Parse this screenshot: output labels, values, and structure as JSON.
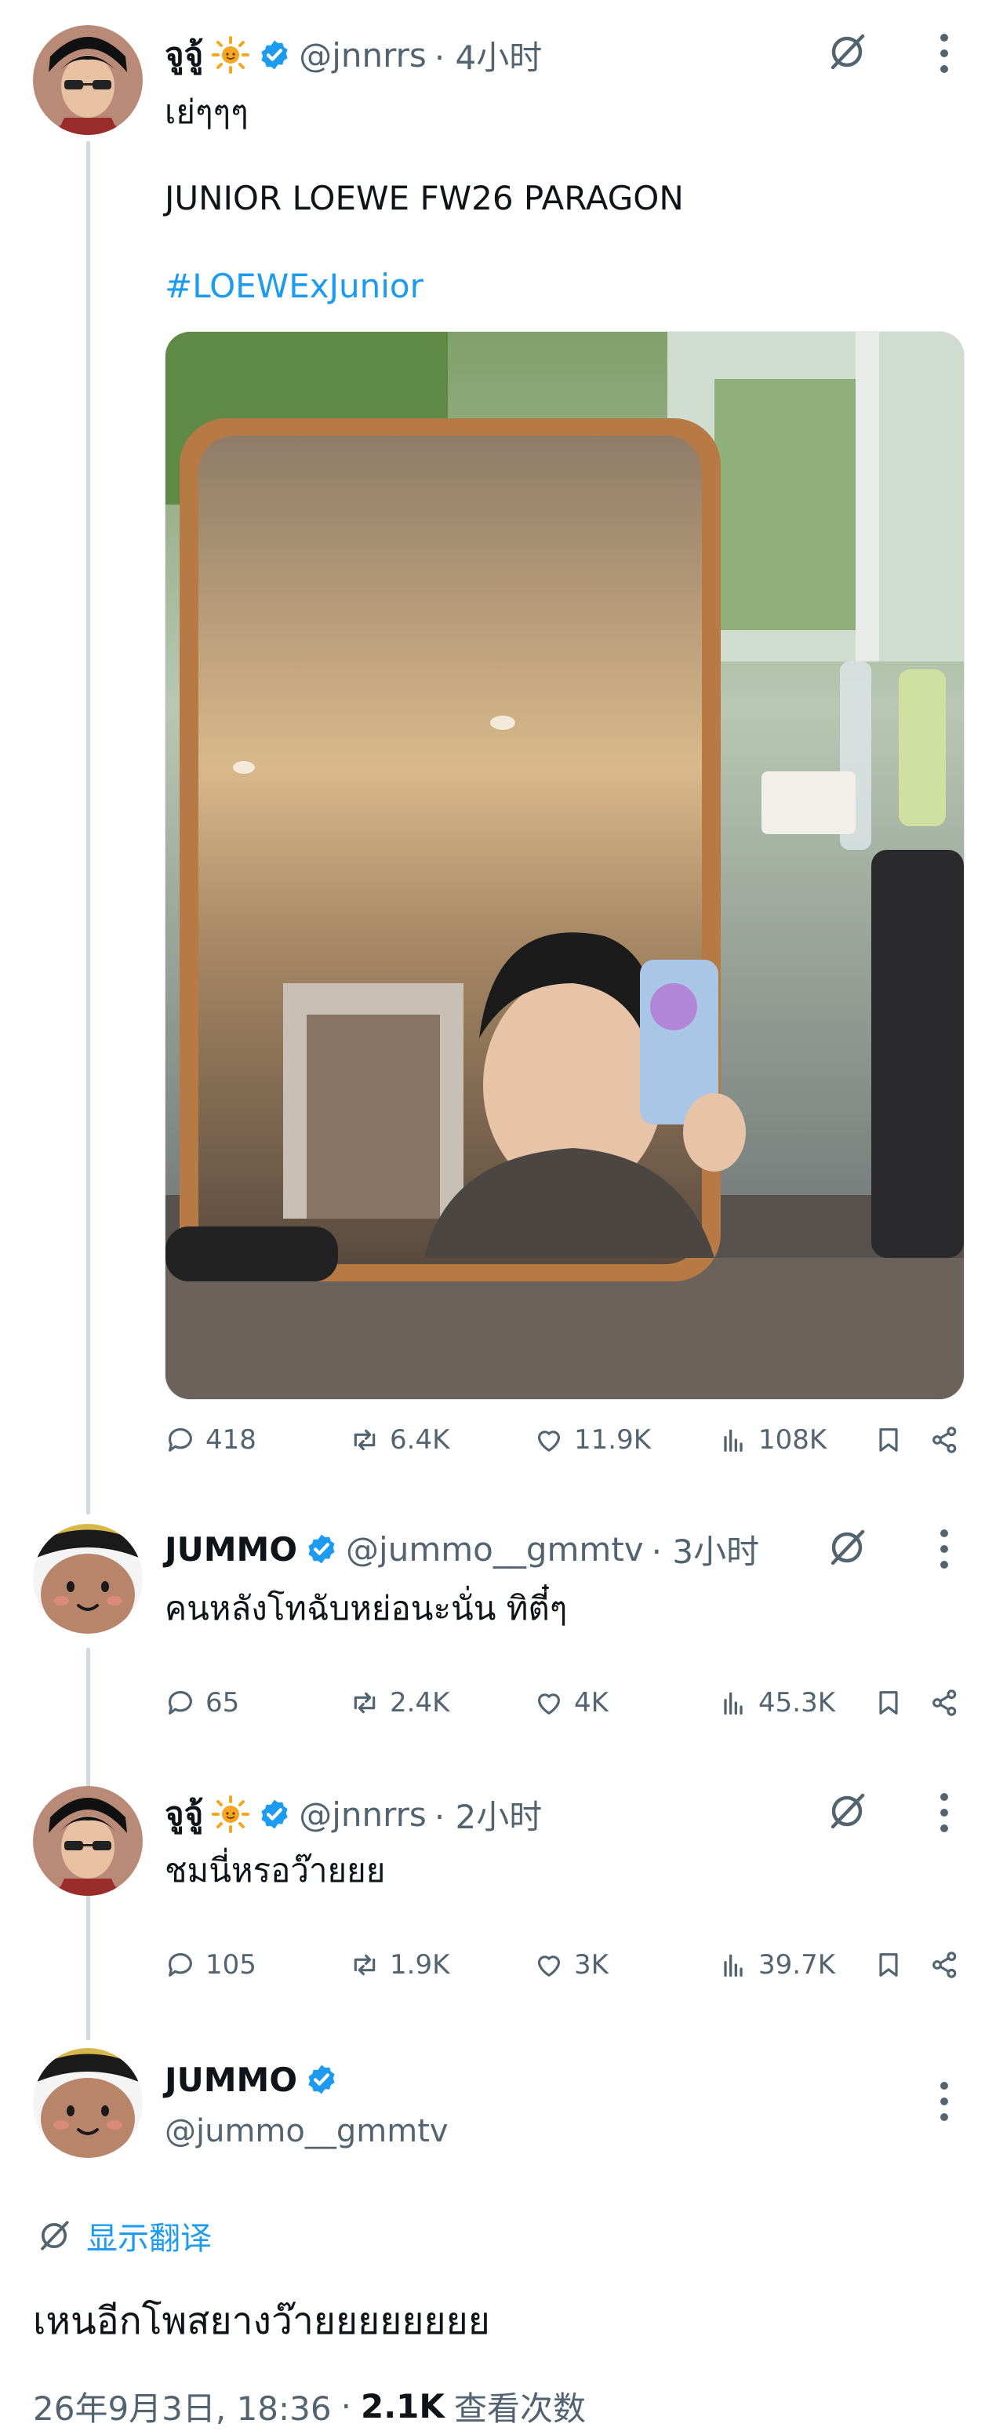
{
  "posts": [
    {
      "display_name": "จูจู้",
      "name_emoji": "sun-emoji",
      "handle": "@jnnrrs",
      "time": "· 4小时",
      "text_line1": "เย่ๆๆๆ",
      "text_line2": "JUNIOR LOEWE FW26 PARAGON",
      "hashtag": "#LOEWExJunior",
      "media": "mirror-selfie-photo",
      "stats": {
        "replies": "418",
        "reposts": "6.4K",
        "likes": "11.9K",
        "views": "108K"
      }
    },
    {
      "display_name": "JUMMO",
      "handle": "@jummo__gmmtv",
      "time": "· 3小时",
      "text": "คนหลังโทฉับหย่อนะนั่น ทิตี๋ๆ",
      "stats": {
        "replies": "65",
        "reposts": "2.4K",
        "likes": "4K",
        "views": "45.3K"
      }
    },
    {
      "display_name": "จูจู้",
      "name_emoji": "sun-emoji",
      "handle": "@jnnrrs",
      "time": "· 2小时",
      "text": "ชมนี่หรอว๊ายยย",
      "stats": {
        "replies": "105",
        "reposts": "1.9K",
        "likes": "3K",
        "views": "39.7K"
      }
    }
  ],
  "focused": {
    "display_name": "JUMMO",
    "handle": "@jummo__gmmtv",
    "translate_label": "显示翻译",
    "text": "เหนอีกโพสยางว๊ายยยยยยยย",
    "date": "26年9月3日, 18:36",
    "views_count": "2.1K",
    "views_label": "查看次数"
  },
  "colors": {
    "accent": "#1d9bf0",
    "secondary_text": "#536471",
    "thread_line": "#cfd9de"
  }
}
